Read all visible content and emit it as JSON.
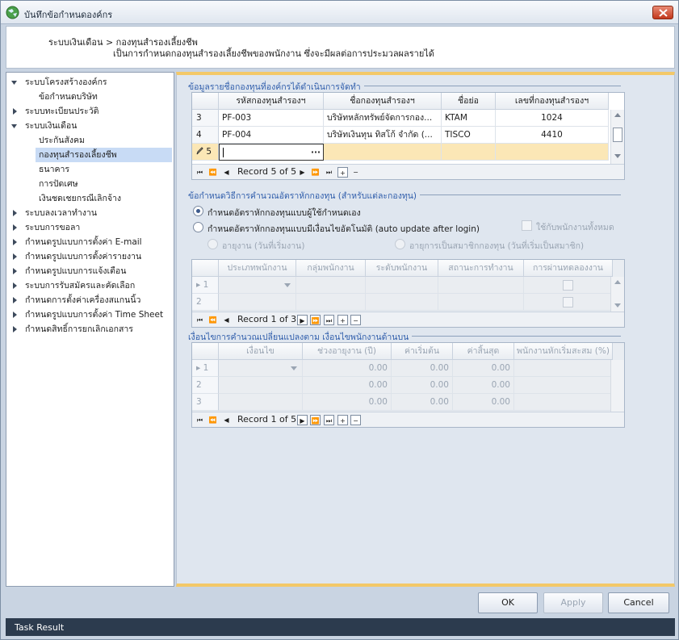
{
  "window": {
    "title": "บันทึกข้อกำหนดองค์กร"
  },
  "header": {
    "breadcrumb": "ระบบเงินเดือน > กองทุนสำรองเลี้ยงชีพ",
    "description": "เป็นการกำหนดกองทุนสำรองเลี้ยงชีพของพนักงาน ซึ่งจะมีผลต่อการประมวลผลรายได้"
  },
  "tree": {
    "items": [
      {
        "label": "ระบบโครงสร้างองค์กร",
        "expanded": true
      },
      {
        "label": "ข้อกำหนดบริษัท"
      },
      {
        "label": "ระบบทะเบียนประวัติ",
        "expanded": false
      },
      {
        "label": "ระบบเงินเดือน",
        "expanded": true
      },
      {
        "label": "ประกันสังคม"
      },
      {
        "label": "กองทุนสำรองเลี้ยงชีพ",
        "selected": true
      },
      {
        "label": "ธนาคาร"
      },
      {
        "label": "การปัดเศษ"
      },
      {
        "label": "เงินชดเชยกรณีเลิกจ้าง"
      },
      {
        "label": "ระบบลงเวลาทำงาน",
        "expanded": false
      },
      {
        "label": "ระบบการขอลา",
        "expanded": false
      },
      {
        "label": "กำหนดรูปแบบการตั้งค่า E-mail",
        "expanded": false
      },
      {
        "label": "กำหนดรูปแบบการตั้งค่ารายงาน",
        "expanded": false
      },
      {
        "label": "กำหนดรูปแบบการแจ้งเตือน",
        "expanded": false
      },
      {
        "label": "ระบบการรับสมัครและคัดเลือก",
        "expanded": false
      },
      {
        "label": "กำหนดการตั้งค่าเครื่องสแกนนิ้ว",
        "expanded": false
      },
      {
        "label": "กำหนดรูปแบบการตั้งค่า Time Sheet",
        "expanded": false
      },
      {
        "label": "กำหนดสิทธิ์การยกเลิกเอกสาร",
        "expanded": false
      }
    ]
  },
  "fund_section": {
    "title": "ข้อมูลรายชื่อกองทุนที่องค์กรได้ดำเนินการจัดทำ",
    "columns": [
      "รหัสกองทุนสำรองฯ",
      "ชื่อกองทุนสำรองฯ",
      "ชื่อย่อ",
      "เลขที่กองทุนสำรองฯ"
    ],
    "rows": [
      {
        "no": "3",
        "code": "PF-003",
        "name": "บริษัทหลักทรัพย์จัดการกอง...",
        "abbr": "KTAM",
        "number": "1024"
      },
      {
        "no": "4",
        "code": "PF-004",
        "name": "บริษัทเงินทุน ทิสโก้ จำกัด (...",
        "abbr": "TISCO",
        "number": "4410"
      }
    ],
    "new_row_no": "5",
    "ellipsis": "···",
    "record": "Record 5 of 5"
  },
  "rate_section": {
    "title": "ข้อกำหนดวิธีการคำนวณอัตราหักกองทุน (สำหรับแต่ละกองทุน)",
    "option_manual": "กำหนดอัตราหักกองทุนแบบผู้ใช้กำหนดเอง",
    "option_auto": "กำหนดอัตราหักกองทุนแบบมีเงื่อนไขอัตโนมัติ (auto update after login)",
    "apply_all": "ใช้กับพนักงานทั้งหมด",
    "sub_option_work": "อายุงาน (วันที่เริ่มงาน)",
    "sub_option_member": "อายุการเป็นสมาชิกกองทุน (วันที่เริ่มเป็นสมาชิก)",
    "columns": [
      "ประเภทพนักงาน",
      "กลุ่มพนักงาน",
      "ระดับพนักงาน",
      "สถานะการทำงาน",
      "การผ่านทดลองงาน"
    ],
    "rows": [
      "1",
      "2"
    ],
    "record": "Record 1 of 3"
  },
  "condition_section": {
    "title": "เงื่อนไขการคำนวณเปลี่ยนแปลงตาม เงื่อนไขพนักงานด้านบน",
    "columns": [
      "เงื่อนไข",
      "ช่วงอายุงาน (ปี)",
      "ค่าเริ่มต้น",
      "ค่าสิ้นสุด",
      "พนักงานหักเริ่มสะสม (%)"
    ],
    "rows": [
      {
        "no": "1",
        "range": "0.00",
        "start": "0.00",
        "end": "0.00"
      },
      {
        "no": "2",
        "range": "0.00",
        "start": "0.00",
        "end": "0.00"
      },
      {
        "no": "3",
        "range": "0.00",
        "start": "0.00",
        "end": "0.00"
      }
    ],
    "record": "Record 1 of 5"
  },
  "footer": {
    "ok": "OK",
    "apply": "Apply",
    "cancel": "Cancel"
  },
  "taskbar": {
    "label": "Task Result"
  }
}
